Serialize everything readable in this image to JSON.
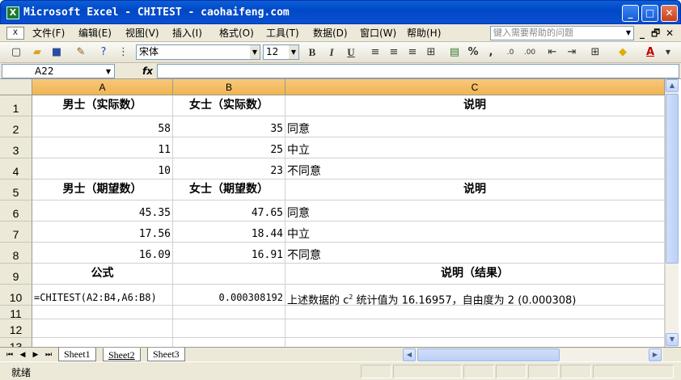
{
  "window": {
    "title": "Microsoft Excel - CHITEST - caohaifeng.com",
    "app_icon": "X",
    "min_glyph": "_",
    "max_glyph": "□",
    "close_glyph": "✕"
  },
  "menubar": {
    "items": [
      "文件(F)",
      "编辑(E)",
      "视图(V)",
      "插入(I)",
      "格式(O)",
      "工具(T)",
      "数据(D)",
      "窗口(W)",
      "帮助(H)"
    ],
    "help_placeholder": "键入需要帮助的问题",
    "doc_min": "_",
    "doc_restore": "🗗",
    "doc_close": "✕"
  },
  "toolbar": {
    "font_name": "宋体",
    "font_size": "12",
    "bold": "B",
    "italic": "I",
    "underline": "U",
    "percent": "%",
    "comma": ",",
    "inc_decimal": ".0",
    "dec_decimal": ".00",
    "font_color_label": "A"
  },
  "formula_bar": {
    "name_box": "A22",
    "fx": "fx",
    "formula": ""
  },
  "columns": [
    "A",
    "B",
    "C"
  ],
  "rows": [
    "1",
    "2",
    "3",
    "4",
    "5",
    "6",
    "7",
    "8",
    "9",
    "10",
    "11",
    "12",
    "13"
  ],
  "cells": {
    "A1": "男士（实际数）",
    "B1": "女士（实际数）",
    "C1": "说明",
    "A2": "58",
    "B2": "35",
    "C2": "同意",
    "A3": "11",
    "B3": "25",
    "C3": "中立",
    "A4": "10",
    "B4": "23",
    "C4": "不同意",
    "A5": "男士（期望数）",
    "B5": "女士（期望数）",
    "C5": "说明",
    "A6": "45.35",
    "B6": "47.65",
    "C6": "同意",
    "A7": "17.56",
    "B7": "18.44",
    "C7": "中立",
    "A8": "16.09",
    "B8": "16.91",
    "C8": "不同意",
    "A9": "公式",
    "B9": "",
    "C9": "说明（结果）",
    "A10": "=CHITEST(A2:B4,A6:B8)",
    "B10": "0.000308192",
    "C10_pre": "上述数据的 c",
    "C10_sup": "2",
    "C10_post": " 统计值为 16.16957，自由度为 2 (0.000308)"
  },
  "sheets": [
    "Sheet1",
    "Sheet2",
    "Sheet3"
  ],
  "active_sheet": "Sheet2",
  "status": "就绪"
}
